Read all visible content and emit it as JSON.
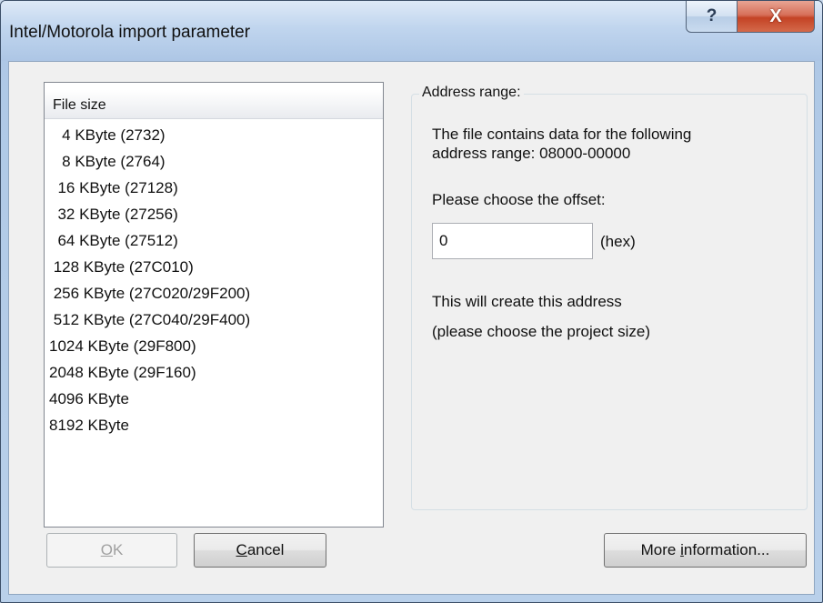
{
  "window": {
    "title": "Intel/Motorola import parameter",
    "help_glyph": "?",
    "close_glyph": "X"
  },
  "file_size_list": {
    "header": "File size",
    "items": [
      "   4 KByte (2732)",
      "   8 KByte (2764)",
      "  16 KByte (27128)",
      "  32 KByte (27256)",
      "  64 KByte (27512)",
      " 128 KByte (27C010)",
      " 256 KByte (27C020/29F200)",
      " 512 KByte (27C040/29F400)",
      "1024 KByte (29F800)",
      "2048 KByte (29F160)",
      "4096 KByte",
      "8192 KByte"
    ]
  },
  "address_range": {
    "title": "Address range:",
    "info_line1": "The file contains data for the following",
    "info_line2": "address range: 08000-00000",
    "offset_label": "Please choose the offset:",
    "offset_value": "0",
    "hex_label": "(hex)",
    "result_line1": "This will create this address",
    "result_line2": "(please choose the project size)"
  },
  "buttons": {
    "ok_mnemonic": "O",
    "ok_rest": "K",
    "cancel_mnemonic": "C",
    "cancel_rest": "ancel",
    "more_pre": "More ",
    "more_mnemonic": "i",
    "more_rest": "nformation..."
  }
}
